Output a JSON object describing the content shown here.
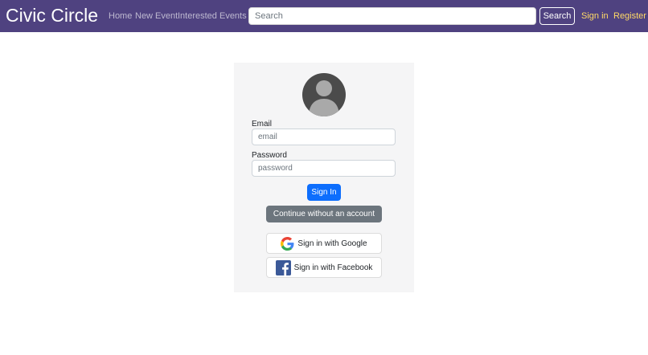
{
  "navbar": {
    "brand": "Civic Circle",
    "links": [
      {
        "label": "Home"
      },
      {
        "label": "New Event"
      },
      {
        "label": "Interested Events"
      }
    ],
    "search": {
      "placeholder": "Search",
      "value": "",
      "button_label": "Search"
    },
    "auth": {
      "signin_label": "Sign in",
      "register_label": "Register"
    }
  },
  "login_card": {
    "avatar_icon": "user-avatar-icon",
    "email_label": "Email",
    "email_placeholder": "email",
    "email_value": "",
    "password_label": "Password",
    "password_placeholder": "password",
    "password_value": "",
    "signin_button": "Sign In",
    "guest_button": "Continue without an account",
    "google_button": "Sign in with Google",
    "facebook_button": "Sign in with Facebook"
  },
  "colors": {
    "navbar_bg": "#4f4280",
    "auth_link": "#ffd966",
    "primary": "#0d6efd",
    "secondary": "#6c757d",
    "card_bg": "#f5f5f6",
    "facebook": "#3b5998"
  }
}
